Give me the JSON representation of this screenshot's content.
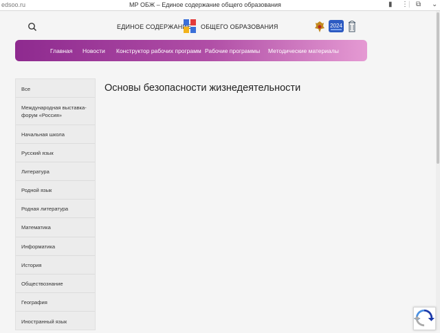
{
  "browser": {
    "url": "edsoo.ru",
    "tab_title": "МР ОБЖ – Единое содержание общего образования"
  },
  "header": {
    "brand_left": "ЕДИНОЕ СОДЕРЖАНИЕ",
    "brand_right": "ОБЩЕГО ОБРАЗОВАНИЯ",
    "badge_year": "2024"
  },
  "nav": {
    "items": [
      "Главная",
      "Новости",
      "Конструктор рабочих программ",
      "Рабочие программы",
      "Методические материалы"
    ]
  },
  "sidebar": {
    "items": [
      "Все",
      "Международная выставка-форум «Россия»",
      "Начальная школа",
      "Русский язык",
      "Литература",
      "Родной язык",
      "Родная литература",
      "Математика",
      "Информатика",
      "История",
      "Обществознание",
      "География",
      "Иностранный язык"
    ]
  },
  "main": {
    "title": "Основы безопасности жизнедеятельности"
  },
  "colors": {
    "nav_start": "#8e2a8f",
    "nav_end": "#e59ad3",
    "sidebar_bg": "#ececec",
    "page_bg": "#f5f5f5"
  }
}
